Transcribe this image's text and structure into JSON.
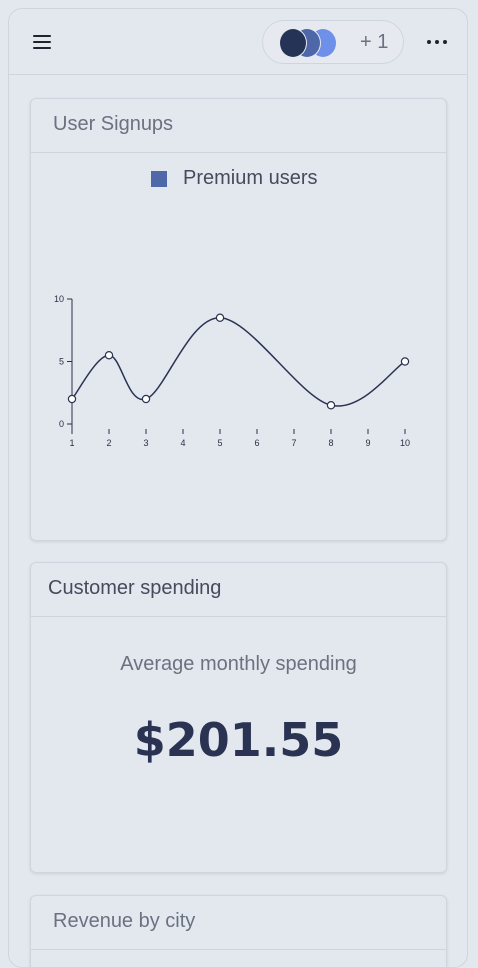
{
  "topbar": {
    "menu_icon": "hamburger-menu-icon",
    "avatars": [
      {
        "color": "#253456"
      },
      {
        "color": "#4e67a8"
      },
      {
        "color": "#6f90e8"
      }
    ],
    "avatar_extra_label": "+ 1",
    "more_icon": "more-horizontal-icon"
  },
  "cards": {
    "signups": {
      "title": "User Signups",
      "legend_label": "Premium users",
      "legend_color": "#4f68a9"
    },
    "spending": {
      "title": "Customer spending",
      "subtitle": "Average monthly spending",
      "value": "$201.55"
    },
    "revenue": {
      "title": "Revenue by city"
    }
  },
  "chart_data": {
    "type": "line",
    "title": "",
    "xlabel": "",
    "ylabel": "",
    "series": [
      {
        "name": "Premium users",
        "x": [
          1,
          2,
          3,
          5,
          8,
          10
        ],
        "values": [
          2,
          5.5,
          2,
          8.5,
          1.5,
          5
        ]
      }
    ],
    "x_ticks": [
      "1",
      "2",
      "3",
      "4",
      "5",
      "6",
      "7",
      "8",
      "9",
      "10"
    ],
    "y_ticks": [
      "0",
      "5",
      "10"
    ],
    "xlim": [
      1,
      10
    ],
    "ylim": [
      0,
      10
    ],
    "line_color": "#2a3352",
    "grid": false,
    "legend": "top-center"
  }
}
